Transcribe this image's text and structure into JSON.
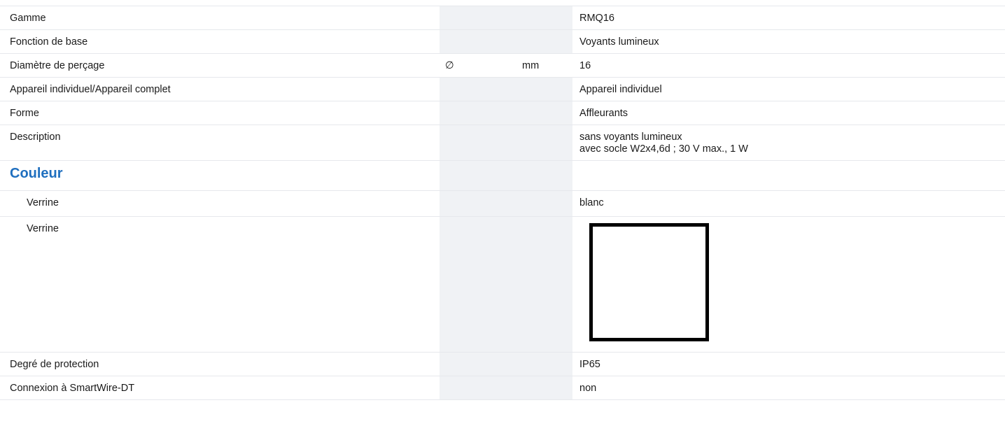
{
  "rows": {
    "gamme": {
      "label": "Gamme",
      "value": "RMQ16"
    },
    "fonction": {
      "label": "Fonction de base",
      "value": "Voyants lumineux"
    },
    "diametre": {
      "label": "Diamètre de perçage",
      "symbol": "∅",
      "unit": "mm",
      "value": "16"
    },
    "appareil": {
      "label": "Appareil individuel/Appareil complet",
      "value": "Appareil individuel"
    },
    "forme": {
      "label": "Forme",
      "value": "Affleurants"
    },
    "description": {
      "label": "Description",
      "value_line1": "sans voyants lumineux",
      "value_line2": "avec socle W2x4,6d ; 30 V max., 1 W"
    },
    "couleur_section": {
      "title": "Couleur"
    },
    "verrine_text": {
      "label": "Verrine",
      "value": "blanc"
    },
    "verrine_swatch": {
      "label": "Verrine",
      "swatch_color": "#ffffff"
    },
    "protection": {
      "label": "Degré de protection",
      "value": "IP65"
    },
    "smartwire": {
      "label": "Connexion à SmartWire-DT",
      "value": "non"
    }
  },
  "colors": {
    "section_title": "#1f6fbf",
    "shaded_column": "#f0f2f5",
    "row_border": "#e6e8ec"
  }
}
